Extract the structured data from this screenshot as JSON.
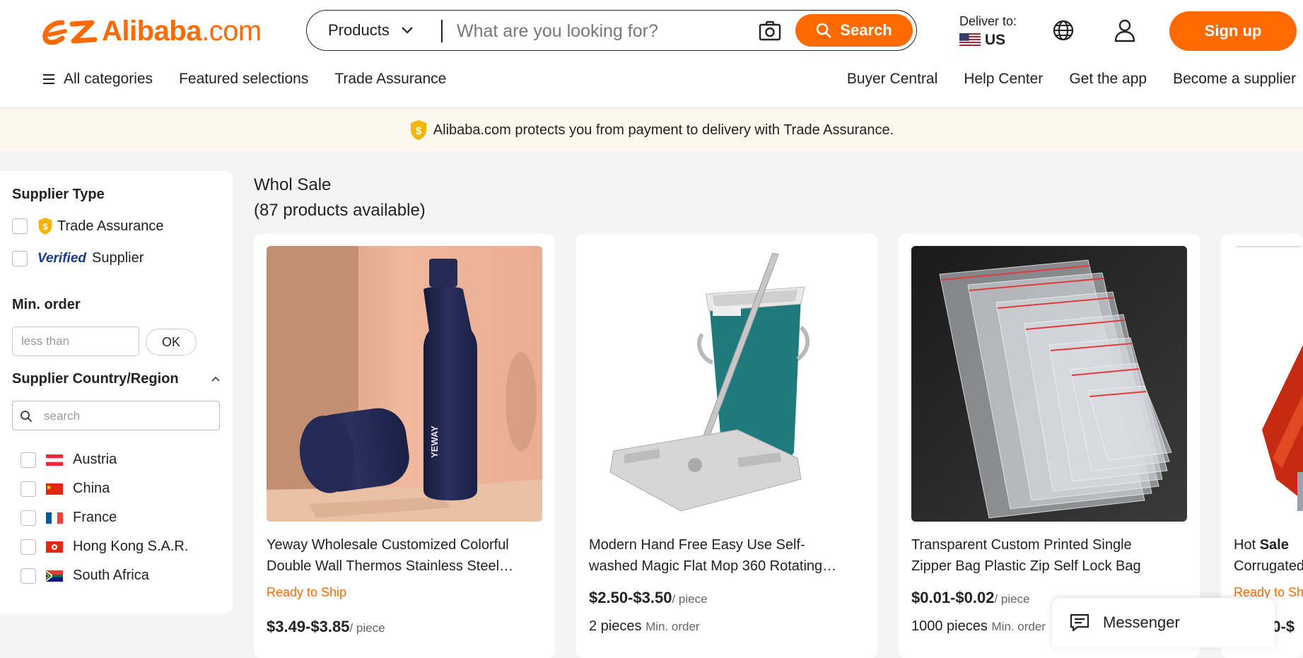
{
  "brand": {
    "logo_text": "Alibaba",
    "logo_suffix": ".com",
    "color": "#ff6a00"
  },
  "search": {
    "category": "Products",
    "placeholder": "What are you looking for?",
    "button_label": "Search",
    "camera_icon": "camera-icon"
  },
  "header": {
    "deliver_label": "Deliver to:",
    "deliver_country": "US",
    "signup_label": "Sign up"
  },
  "nav": {
    "left": [
      "All categories",
      "Featured selections",
      "Trade Assurance"
    ],
    "right": [
      "Buyer Central",
      "Help Center",
      "Get the app",
      "Become a supplier"
    ]
  },
  "banner": {
    "text": "Alibaba.com protects you from payment to delivery with Trade Assurance."
  },
  "sidebar": {
    "supplier_type_heading": "Supplier Type",
    "supplier_types": [
      {
        "label": "Trade Assurance"
      },
      {
        "brand": "Verified",
        "label": "Supplier"
      }
    ],
    "min_order_heading": "Min. order",
    "min_order_placeholder": "less than",
    "ok_label": "OK",
    "country_heading": "Supplier Country/Region",
    "country_search_placeholder": "search",
    "countries": [
      "Austria",
      "China",
      "France",
      "Hong Kong S.A.R.",
      "South Africa"
    ]
  },
  "results": {
    "query": "Whol Sale",
    "count_text": "(87 products available)"
  },
  "products": [
    {
      "title_line1": "Yeway Wholesale Customized Colorful",
      "title_line2": "Double Wall Thermos Stainless Steel…",
      "tag": "Ready to Ship",
      "price": "$3.49-$3.85",
      "unit": "/ piece"
    },
    {
      "title_line1": "Modern Hand Free Easy Use Self-",
      "title_line2": "washed Magic Flat Mop 360 Rotating…",
      "price": "$2.50-$3.50",
      "unit": "/ piece",
      "moq": "2 pieces",
      "moq_label": "Min. order"
    },
    {
      "title_line1": "Transparent Custom Printed Single",
      "title_line2": "Zipper Bag Plastic Zip Self Lock Bag",
      "price": "$0.01-$0.02",
      "unit": "/ piece",
      "moq": "1000 pieces",
      "moq_label": "Min. order"
    },
    {
      "title_prefix": "Hot ",
      "title_bold": "Sale",
      "title_line2": "Corrugated",
      "tag": "Ready to Sh",
      "price": "00-$"
    }
  ],
  "bottle_brand": "YEWAY",
  "messenger": {
    "label": "Messenger"
  }
}
